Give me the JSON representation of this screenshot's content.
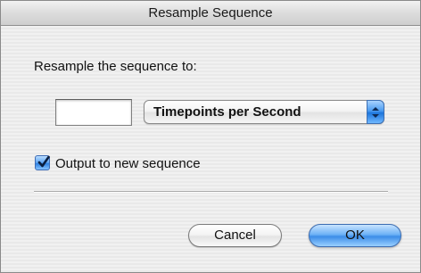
{
  "window": {
    "title": "Resample Sequence"
  },
  "form": {
    "prompt": "Resample the sequence to:",
    "rate_value": "",
    "unit_select": {
      "selected": "Timepoints per Second"
    },
    "output_checkbox": {
      "label": "Output to new sequence",
      "checked": true
    }
  },
  "buttons": {
    "cancel_label": "Cancel",
    "ok_label": "OK"
  },
  "colors": {
    "accent": "#3c8de8",
    "window_bg": "#eeeeee"
  },
  "icons": {
    "popup_arrows": "up-down-arrows-icon",
    "checkmark": "checkmark-icon"
  }
}
